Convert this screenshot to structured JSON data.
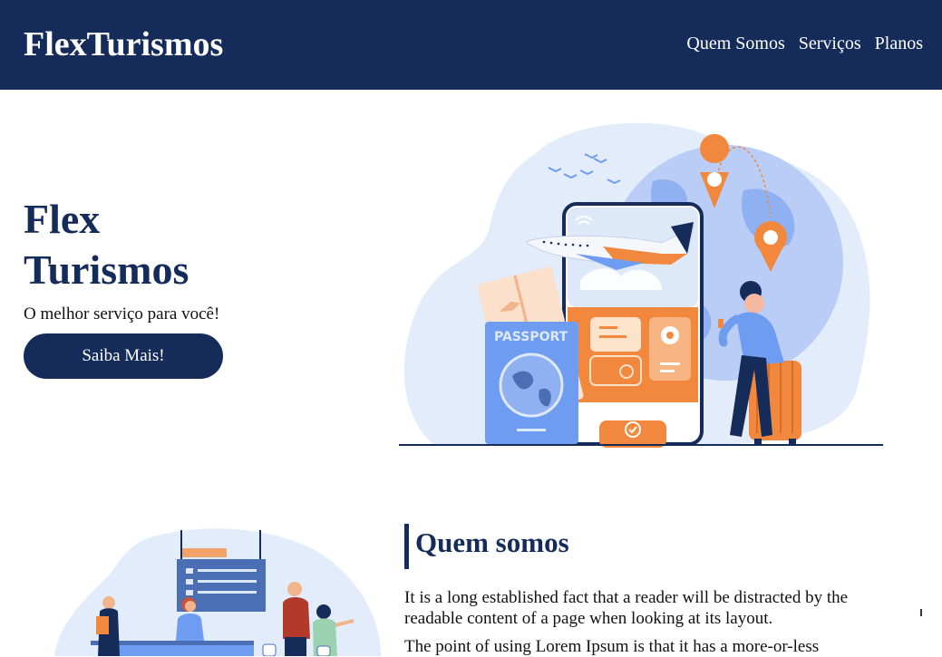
{
  "header": {
    "logo": "FlexTurismos",
    "nav": [
      "Quem Somos",
      "Serviços",
      "Planos"
    ]
  },
  "hero": {
    "title_line1": "Flex",
    "title_line2": "Turismos",
    "subtitle": "O melhor serviço para você!",
    "cta_label": "Saiba Mais!",
    "illustration": {
      "passport_text": "PASSPORT",
      "icons": [
        "airplane-icon",
        "location-pin-icon",
        "wifi-icon",
        "checkmark-icon",
        "clock-icon",
        "globe-icon"
      ]
    }
  },
  "about": {
    "title": "Quem somos",
    "paragraph1": "It is a long established fact that a reader will be distracted by the readable content of a page when looking at its layout.",
    "paragraph2": "The point of using Lorem Ipsum is that it has a more-or-less"
  },
  "colors": {
    "navy": "#152c5b",
    "orange": "#f2883d",
    "light_blue": "#dde8f9",
    "mid_blue": "#6e9cf0"
  }
}
